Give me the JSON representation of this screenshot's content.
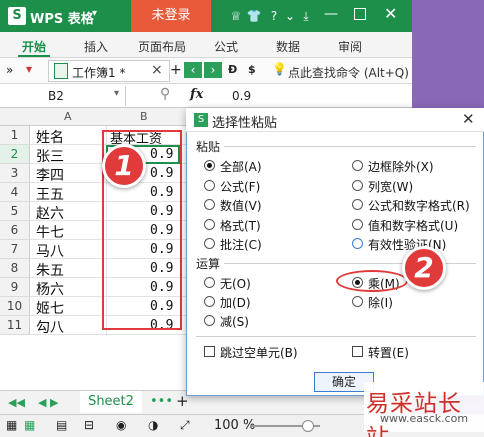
{
  "titlebar": {
    "app_name": "WPS 表格",
    "dropdown": "▾",
    "login": "未登录"
  },
  "menu": [
    "开始",
    "插入",
    "页面布局",
    "公式",
    "数据",
    "审阅"
  ],
  "toolbar": {
    "doc_name": "工作簿1 *",
    "search_hint": "点此查找命令 (Alt+Q)"
  },
  "formula_bar": {
    "cell_ref": "B2",
    "fx": "fx",
    "value": "0.9"
  },
  "columns": [
    "A",
    "B"
  ],
  "rows": [
    {
      "num": "1",
      "a": "姓名",
      "b": "基本工资"
    },
    {
      "num": "2",
      "a": "张三",
      "b": "0.9"
    },
    {
      "num": "3",
      "a": "李四",
      "b": "0.9"
    },
    {
      "num": "4",
      "a": "王五",
      "b": "0.9"
    },
    {
      "num": "5",
      "a": "赵六",
      "b": "0.9"
    },
    {
      "num": "6",
      "a": "牛七",
      "b": "0.9"
    },
    {
      "num": "7",
      "a": "马八",
      "b": "0.9"
    },
    {
      "num": "8",
      "a": "朱五",
      "b": "0.9"
    },
    {
      "num": "9",
      "a": "杨六",
      "b": "0.9"
    },
    {
      "num": "10",
      "a": "姬七",
      "b": "0.9"
    },
    {
      "num": "11",
      "a": "勾八",
      "b": "0.9"
    }
  ],
  "sheet_tab": "Sheet2",
  "status": {
    "zoom": "100 %"
  },
  "dialog": {
    "title": "选择性粘贴",
    "paste_group": "粘贴",
    "paste_options": [
      {
        "label": "全部(A)",
        "checked": true
      },
      {
        "label": "公式(F)",
        "checked": false
      },
      {
        "label": "数值(V)",
        "checked": false
      },
      {
        "label": "格式(T)",
        "checked": false
      },
      {
        "label": "批注(C)",
        "checked": false
      }
    ],
    "paste_options_right": [
      {
        "label": "边框除外(X)",
        "checked": false
      },
      {
        "label": "列宽(W)",
        "checked": false
      },
      {
        "label": "公式和数字格式(R)",
        "checked": false
      },
      {
        "label": "值和数字格式(U)",
        "checked": false
      },
      {
        "label": "有效性验证(N)",
        "checked": false
      }
    ],
    "op_group": "运算",
    "op_options": [
      {
        "label": "无(O)",
        "checked": false
      },
      {
        "label": "加(D)",
        "checked": false
      },
      {
        "label": "减(S)",
        "checked": false
      }
    ],
    "op_options_right": [
      {
        "label": "乘(M)",
        "checked": true
      },
      {
        "label": "除(I)",
        "checked": false
      }
    ],
    "skip_blanks": "跳过空单元(B)",
    "transpose": "转置(E)",
    "ok": "确定"
  },
  "annotations": {
    "badge1": "1",
    "badge2": "2"
  },
  "watermark": {
    "text": "易采站长站",
    "url": "www.easck.com"
  }
}
